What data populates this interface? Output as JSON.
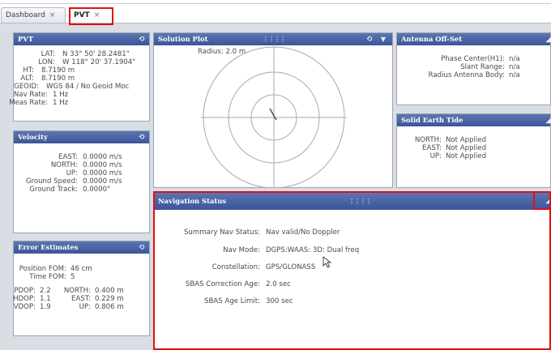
{
  "tabs": [
    {
      "label": "Dashboard",
      "close": "×"
    },
    {
      "label": "PVT",
      "close": "×"
    }
  ],
  "pvt": {
    "title": "PVT",
    "rows": [
      {
        "label": "LAT:",
        "value": "N 33° 50' 28.2481\""
      },
      {
        "label": "LON:",
        "value": "W 118° 20' 37.1904\""
      },
      {
        "label": "HT:",
        "value": "8.7190 m"
      },
      {
        "label": "ALT:",
        "value": "8.7190 m"
      },
      {
        "label": "GEOID:",
        "value": "WGS 84 / No Geoid Moc"
      },
      {
        "label": "Nav Rate:",
        "value": "1 Hz"
      },
      {
        "label": "Meas Rate:",
        "value": "1 Hz"
      }
    ]
  },
  "velocity": {
    "title": "Velocity",
    "rows": [
      {
        "label": "EAST:",
        "value": "0.0000 m/s"
      },
      {
        "label": "NORTH:",
        "value": "0.0000 m/s"
      },
      {
        "label": "UP:",
        "value": "0.0000 m/s"
      },
      {
        "label": "Ground Speed:",
        "value": "0.0000 m/s"
      },
      {
        "label": "Ground Track:",
        "value": "0.0000°"
      }
    ]
  },
  "error": {
    "title": "Error Estimates",
    "position_fom": {
      "label": "Position FOM:",
      "value": "46 cm"
    },
    "time_fom": {
      "label": "Time FOM:",
      "value": "5"
    },
    "dop_rows": [
      {
        "label": "PDOP:",
        "value": "2.2",
        "dir_label": "NORTH:",
        "dir_value": "0.400 m"
      },
      {
        "label": "HDOP:",
        "value": "1.1",
        "dir_label": "EAST:",
        "dir_value": "0.229 m"
      },
      {
        "label": "VDOP:",
        "value": "1.9",
        "dir_label": "UP:",
        "dir_value": "0.806 m"
      }
    ]
  },
  "solution": {
    "title": "Solution Plot",
    "radius": "Radius: 2.0 m"
  },
  "antenna": {
    "title": "Antenna Off-Set",
    "rows": [
      {
        "label": "Phase Center(H1):",
        "value": "n/a"
      },
      {
        "label": "Slant Range:",
        "value": "n/a"
      },
      {
        "label": "Radius Antenna Body:",
        "value": "n/a"
      }
    ]
  },
  "tide": {
    "title": "Solid Earth Tide",
    "rows": [
      {
        "label": "NORTH:",
        "value": "Not Applied"
      },
      {
        "label": "EAST:",
        "value": "Not Applied"
      },
      {
        "label": "UP:",
        "value": "Not Applied"
      }
    ]
  },
  "nav": {
    "title": "Navigation Status",
    "rows": [
      {
        "label": "Summary Nav Status:",
        "value": "Nav valid/No Doppler"
      },
      {
        "label": "Nav Mode:",
        "value": "DGPS:WAAS: 3D: Dual freq"
      },
      {
        "label": "Constellation:",
        "value": "GPS/GLONASS"
      },
      {
        "label": "SBAS Correction Age:",
        "value": "2.0 sec"
      },
      {
        "label": "SBAS Age Limit:",
        "value": "300 sec"
      }
    ]
  },
  "icons": {
    "refresh": "refresh-icon",
    "menu": "menu-icon",
    "grip": "drag-grip-icon",
    "cursor": "mouse-cursor-icon",
    "collapse": "collapse-icon"
  },
  "colors": {
    "title_bar": "#3a5699",
    "highlight": "#e01010",
    "workspace": "#d9dde4"
  }
}
